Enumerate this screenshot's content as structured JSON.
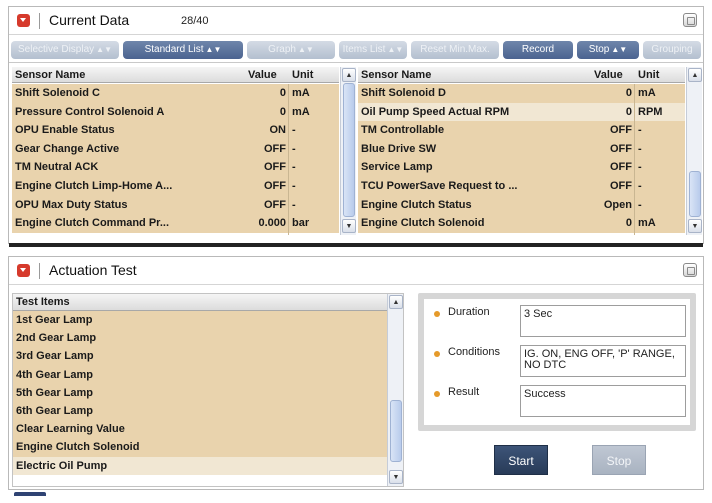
{
  "current_data": {
    "title": "Current Data",
    "count": "28/40",
    "toolbar": [
      {
        "label": "Selective Display",
        "state": "disabled",
        "dropdown": true
      },
      {
        "label": "Standard List",
        "state": "active",
        "dropdown": true
      },
      {
        "label": "Graph",
        "state": "disabled",
        "dropdown": true
      },
      {
        "label": "Items List",
        "state": "disabled",
        "dropdown": true
      },
      {
        "label": "Reset Min.Max.",
        "state": "disabled",
        "dropdown": false
      },
      {
        "label": "Record",
        "state": "active",
        "dropdown": false
      },
      {
        "label": "Stop",
        "state": "active",
        "dropdown": true
      },
      {
        "label": "Grouping",
        "state": "disabled",
        "dropdown": false
      }
    ],
    "columns": {
      "name": "Sensor Name",
      "value": "Value",
      "unit": "Unit"
    },
    "left_rows": [
      {
        "name": "Shift Solenoid C",
        "value": "0",
        "unit": "mA"
      },
      {
        "name": "Pressure Control Solenoid A",
        "value": "0",
        "unit": "mA"
      },
      {
        "name": "OPU Enable Status",
        "value": "ON",
        "unit": "-"
      },
      {
        "name": "Gear Change Active",
        "value": "OFF",
        "unit": "-"
      },
      {
        "name": "TM Neutral ACK",
        "value": "OFF",
        "unit": "-"
      },
      {
        "name": "Engine Clutch Limp-Home A...",
        "value": "OFF",
        "unit": "-"
      },
      {
        "name": "OPU Max Duty Status",
        "value": "OFF",
        "unit": "-"
      },
      {
        "name": "Engine Clutch Command Pr...",
        "value": "0.000",
        "unit": "bar"
      }
    ],
    "right_rows": [
      {
        "name": "Shift Solenoid D",
        "value": "0",
        "unit": "mA"
      },
      {
        "name": "Oil Pump Speed Actual RPM",
        "value": "0",
        "unit": "RPM"
      },
      {
        "name": "TM Controllable",
        "value": "OFF",
        "unit": "-"
      },
      {
        "name": "Blue Drive SW",
        "value": "OFF",
        "unit": "-"
      },
      {
        "name": "Service Lamp",
        "value": "OFF",
        "unit": "-"
      },
      {
        "name": "TCU PowerSave Request to ...",
        "value": "OFF",
        "unit": "-"
      },
      {
        "name": "Engine Clutch Status",
        "value": "Open",
        "unit": "-"
      },
      {
        "name": "Engine Clutch Solenoid",
        "value": "0",
        "unit": "mA"
      }
    ]
  },
  "actuation_test": {
    "title": "Actuation Test",
    "list_header": "Test Items",
    "items": [
      "1st Gear Lamp",
      "2nd Gear Lamp",
      "3rd Gear Lamp",
      "4th Gear Lamp",
      "5th Gear Lamp",
      "6th Gear Lamp",
      "Clear Learning Value",
      "Engine Clutch Solenoid",
      "Electric Oil Pump"
    ],
    "duration_label": "Duration",
    "duration_value": "3 Sec",
    "conditions_label": "Conditions",
    "conditions_value": "IG. ON, ENG OFF, 'P' RANGE, NO DTC",
    "result_label": "Result",
    "result_value": "Success",
    "start_label": "Start",
    "stop_label": "Stop"
  },
  "colors": {
    "row_tan": "#e9d3ad",
    "row_highlight": "#f1e7d3",
    "header_icon_red": "#d63a2c",
    "button_active": "#4b6390",
    "start_button": "#2f4467",
    "bullet_orange": "#e59a2a"
  },
  "icons": {
    "panel_collapse": "chevron-down-icon",
    "window_restore": "restore-icon",
    "bullet": "dot-icon"
  }
}
